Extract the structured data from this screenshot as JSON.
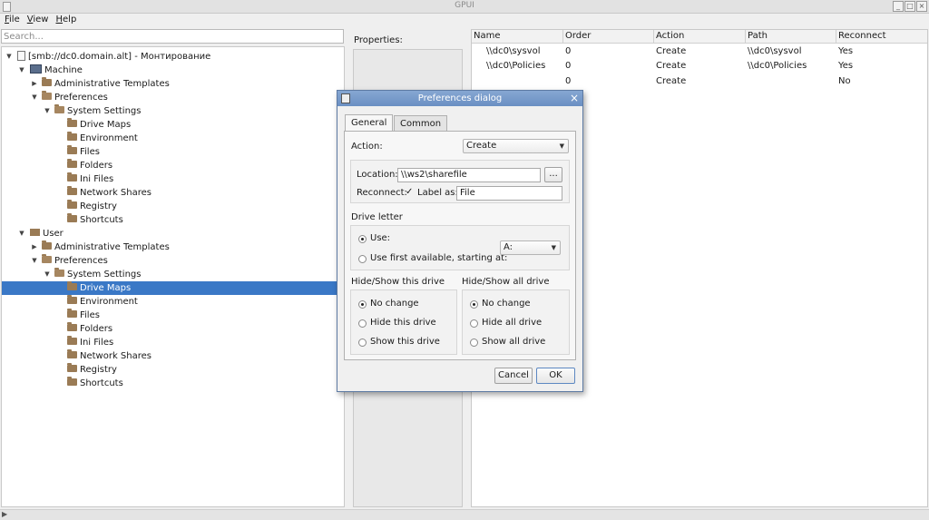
{
  "window": {
    "title": "GPUI"
  },
  "menu": {
    "file": "File",
    "view": "View",
    "help": "Help"
  },
  "search": {
    "placeholder": "Search..."
  },
  "tree": {
    "root": "[smb://dc0.domain.alt] - Монтирование",
    "machine": "Machine",
    "user": "User",
    "admin_templates": "Administrative Templates",
    "preferences": "Preferences",
    "system_settings": "System Settings",
    "items": [
      "Drive Maps",
      "Environment",
      "Files",
      "Folders",
      "Ini Files",
      "Network Shares",
      "Registry",
      "Shortcuts"
    ]
  },
  "properties": {
    "label": "Properties:"
  },
  "grid": {
    "columns": [
      "Name",
      "Order",
      "Action",
      "Path",
      "Reconnect"
    ],
    "rows": [
      [
        "\\\\dc0\\sysvol",
        "0",
        "Create",
        "\\\\dc0\\sysvol",
        "Yes"
      ],
      [
        "\\\\dc0\\Policies",
        "0",
        "Create",
        "\\\\dc0\\Policies",
        "Yes"
      ],
      [
        "",
        "0",
        "Create",
        "",
        "No"
      ]
    ]
  },
  "dialog": {
    "title": "Preferences dialog",
    "tabs": [
      "General",
      "Common"
    ],
    "action_label": "Action:",
    "action_value": "Create",
    "location_label": "Location:",
    "location_value": "\\\\ws2\\sharefile",
    "browse_label": "...",
    "reconnect_label": "Reconnect:",
    "reconnect_check": "✓",
    "label_as_label": "Label as:",
    "label_as_value": "File",
    "drive_letter_title": "Drive letter",
    "use_label": "Use:",
    "use_first_label": "Use first available, starting at:",
    "drive_value": "A:",
    "hide_show_this_title": "Hide/Show this drive",
    "hide_show_all_title": "Hide/Show all drive",
    "this_options": [
      "No change",
      "Hide this drive",
      "Show this drive"
    ],
    "all_options": [
      "No change",
      "Hide all drive",
      "Show all drive"
    ],
    "cancel": "Cancel",
    "ok": "OK"
  }
}
